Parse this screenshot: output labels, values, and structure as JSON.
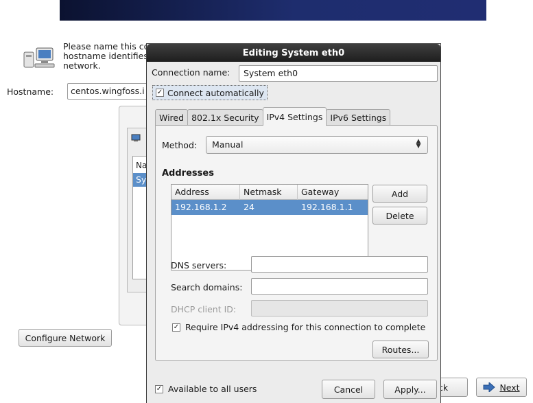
{
  "background": {
    "intro_lines": [
      "Please name this co",
      "hostname identifies",
      "network."
    ],
    "hostname_label": "Hostname:",
    "hostname_value": "centos.wingfoss.i",
    "panel_list_header": "Na",
    "panel_list_selected": "Sy",
    "configure_network_label": "Configure Network",
    "back_label": "ck",
    "next_label": "Next"
  },
  "dialog": {
    "title": "Editing System eth0",
    "connection_name_label": "Connection name:",
    "connection_name_value": "System eth0",
    "connect_automatically_label": "Connect automatically",
    "connect_automatically_checked": true,
    "tabs": [
      {
        "label": "Wired",
        "active": false
      },
      {
        "label": "802.1x Security",
        "active": false
      },
      {
        "label": "IPv4 Settings",
        "active": true
      },
      {
        "label": "IPv6 Settings",
        "active": false
      }
    ],
    "method_label": "Method:",
    "method_value": "Manual",
    "addresses_heading": "Addresses",
    "address_table": {
      "columns": [
        "Address",
        "Netmask",
        "Gateway"
      ],
      "rows": [
        {
          "address": "192.168.1.2",
          "netmask": "24",
          "gateway": "192.168.1.1",
          "selected": true
        }
      ]
    },
    "add_label": "Add",
    "delete_label": "Delete",
    "dns_servers_label": "DNS servers:",
    "dns_servers_value": "",
    "search_domains_label": "Search domains:",
    "search_domains_value": "",
    "dhcp_client_id_label": "DHCP client ID:",
    "dhcp_client_id_value": "",
    "require_ipv4_label": "Require IPv4 addressing for this connection to complete",
    "require_ipv4_checked": true,
    "routes_label": "Routes...",
    "available_to_all_label": "Available to all users",
    "available_to_all_checked": true,
    "cancel_label": "Cancel",
    "apply_label": "Apply..."
  },
  "colors": {
    "selection": "#5b8fc9",
    "titlebar": "#2a2a2a",
    "banner": "#1e2d6e"
  }
}
